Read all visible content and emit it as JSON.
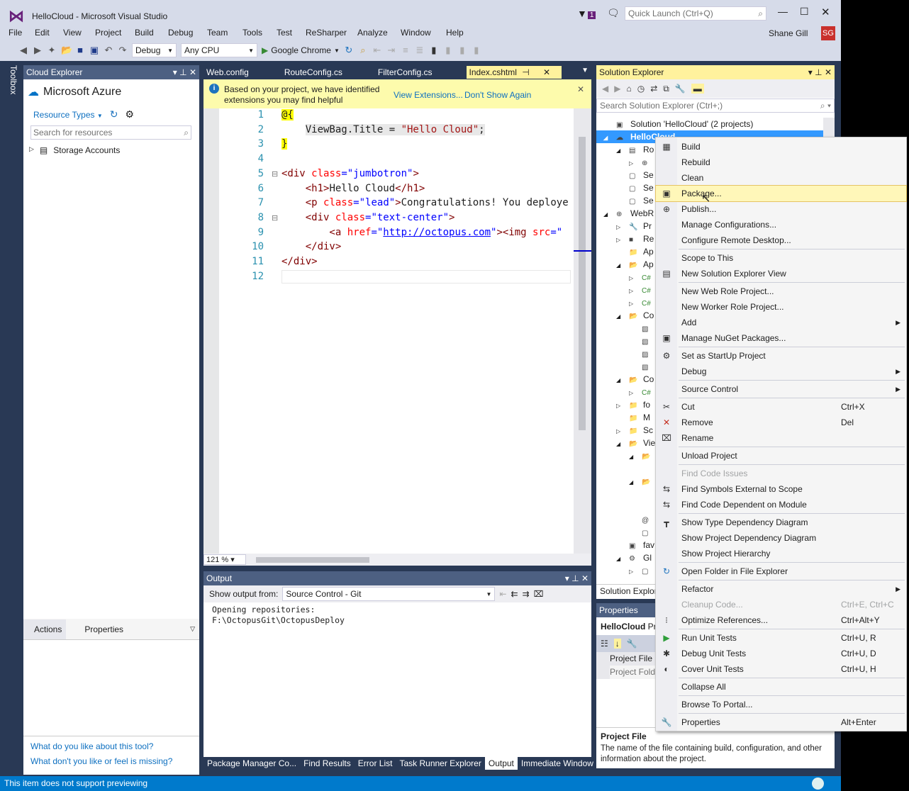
{
  "window": {
    "title": "HelloCloud - Microsoft Visual Studio",
    "notification_count": "1",
    "quick_launch_placeholder": "Quick Launch (Ctrl+Q)",
    "user_name": "Shane Gill",
    "user_initials": "SG",
    "accent": "#007acc"
  },
  "menu": [
    "File",
    "Edit",
    "View",
    "Project",
    "Build",
    "Debug",
    "Team",
    "Tools",
    "Test",
    "ReSharper",
    "Analyze",
    "Window",
    "Help"
  ],
  "toolbar": {
    "configuration": "Debug",
    "platform": "Any CPU",
    "run_target": "Google Chrome"
  },
  "toolbox_label": "Toolbox",
  "cloud_explorer": {
    "title": "Cloud Explorer",
    "account": "Microsoft Azure",
    "resource_types": "Resource Types",
    "search_placeholder": "Search for resources",
    "tree": [
      "Storage Accounts"
    ],
    "tabs": [
      "Actions",
      "Properties"
    ],
    "feedback_links": [
      "What do you like about this tool?",
      "What don't you like or feel is missing?"
    ]
  },
  "editor": {
    "tabs": [
      "Web.config",
      "RouteConfig.cs",
      "FilterConfig.cs",
      "Index.cshtml"
    ],
    "active_tab": "Index.cshtml",
    "infobar": {
      "message_line1": "Based on your project, we have identified",
      "message_line2": "extensions you may find helpful",
      "view_extensions": "View Extensions...",
      "dont_show": "Don't Show Again"
    },
    "zoom": "121 %",
    "lines": [
      [
        [
          "@{",
          "razor"
        ]
      ],
      [
        [
          "    ",
          ""
        ],
        [
          "ViewBag.Title = ",
          "cs"
        ],
        [
          "\"Hello Cloud\"",
          "csstr"
        ],
        [
          ";",
          "cs"
        ]
      ],
      [
        [
          "}",
          "razor"
        ]
      ],
      [],
      [
        [
          "<div ",
          "tag"
        ],
        [
          "class",
          "attr"
        ],
        [
          "=\"jumbotron\"",
          "str"
        ],
        [
          ">",
          "tag"
        ]
      ],
      [
        [
          "    <h1>",
          "tag"
        ],
        [
          "Hello Cloud",
          "plain"
        ],
        [
          "</h1>",
          "tag"
        ]
      ],
      [
        [
          "    <p ",
          "tag"
        ],
        [
          "class",
          "attr"
        ],
        [
          "=\"lead\"",
          "str"
        ],
        [
          ">",
          "tag"
        ],
        [
          "Congratulations! You deploye",
          "plain"
        ]
      ],
      [
        [
          "    <div ",
          "tag"
        ],
        [
          "class",
          "attr"
        ],
        [
          "=\"text-center\"",
          "str"
        ],
        [
          ">",
          "tag"
        ]
      ],
      [
        [
          "        <a ",
          "tag"
        ],
        [
          "href",
          "attr"
        ],
        [
          "=\"",
          "str"
        ],
        [
          "http://octopus.com",
          "link"
        ],
        [
          "\"",
          "str"
        ],
        [
          "><img ",
          "tag"
        ],
        [
          "src",
          "attr"
        ],
        [
          "=\"",
          "str"
        ]
      ],
      [
        [
          "    </div>",
          "tag"
        ]
      ],
      [
        [
          "</div>",
          "tag"
        ]
      ],
      []
    ]
  },
  "output": {
    "title": "Output",
    "show_from_label": "Show output from:",
    "source": "Source Control - Git",
    "text": [
      "Opening repositories:",
      "F:\\OctopusGit\\OctopusDeploy"
    ]
  },
  "bottom_tabs": [
    "Package Manager Co...",
    "Find Results",
    "Error List",
    "Task Runner Explorer",
    "Output",
    "Immediate Window"
  ],
  "bottom_active": "Output",
  "solution_explorer": {
    "title": "Solution Explorer",
    "search_placeholder": "Search Solution Explorer (Ctrl+;)",
    "footer_tab": "Solution Explor",
    "tree": [
      {
        "label": "Solution 'HelloCloud' (2 projects)",
        "depth": 0,
        "exp": "",
        "icon": "▣"
      },
      {
        "label": "HelloCloud",
        "depth": 0,
        "exp": "◢",
        "icon": "☁",
        "selected": true
      },
      {
        "label": "Ro",
        "depth": 1,
        "exp": "◢",
        "icon": "▤"
      },
      {
        "label": "",
        "depth": 2,
        "exp": "▷",
        "icon": "⊕"
      },
      {
        "label": "Se",
        "depth": 1,
        "exp": "",
        "icon": "▢"
      },
      {
        "label": "Se",
        "depth": 1,
        "exp": "",
        "icon": "▢"
      },
      {
        "label": "Se",
        "depth": 1,
        "exp": "",
        "icon": "▢"
      },
      {
        "label": "WebR",
        "depth": 0,
        "exp": "◢",
        "icon": "⊕"
      },
      {
        "label": "Pr",
        "depth": 1,
        "exp": "▷",
        "icon": "🔧"
      },
      {
        "label": "Re",
        "depth": 1,
        "exp": "▷",
        "icon": "■"
      },
      {
        "label": "Ap",
        "depth": 1,
        "exp": "",
        "icon": "📁"
      },
      {
        "label": "Ap",
        "depth": 1,
        "exp": "◢",
        "icon": "📂"
      },
      {
        "label": "",
        "depth": 2,
        "exp": "▷",
        "icon": "C#"
      },
      {
        "label": "",
        "depth": 2,
        "exp": "▷",
        "icon": "C#"
      },
      {
        "label": "",
        "depth": 2,
        "exp": "▷",
        "icon": "C#"
      },
      {
        "label": "Co",
        "depth": 1,
        "exp": "◢",
        "icon": "📂"
      },
      {
        "label": "",
        "depth": 2,
        "exp": "",
        "icon": "▧"
      },
      {
        "label": "",
        "depth": 2,
        "exp": "",
        "icon": "▧"
      },
      {
        "label": "",
        "depth": 2,
        "exp": "",
        "icon": "▨"
      },
      {
        "label": "",
        "depth": 2,
        "exp": "",
        "icon": "▧"
      },
      {
        "label": "Co",
        "depth": 1,
        "exp": "◢",
        "icon": "📂"
      },
      {
        "label": "",
        "depth": 2,
        "exp": "▷",
        "icon": "C#"
      },
      {
        "label": "fo",
        "depth": 1,
        "exp": "▷",
        "icon": "📁"
      },
      {
        "label": "M",
        "depth": 1,
        "exp": "",
        "icon": "📁"
      },
      {
        "label": "Sc",
        "depth": 1,
        "exp": "▷",
        "icon": "📁"
      },
      {
        "label": "Vie",
        "depth": 1,
        "exp": "◢",
        "icon": "📂"
      },
      {
        "label": "",
        "depth": 2,
        "exp": "◢",
        "icon": "📂"
      },
      {
        "label": "",
        "depth": 3,
        "exp": "",
        "icon": ""
      },
      {
        "label": "",
        "depth": 2,
        "exp": "◢",
        "icon": "📂"
      },
      {
        "label": "",
        "depth": 3,
        "exp": "",
        "icon": ""
      },
      {
        "label": "",
        "depth": 3,
        "exp": "",
        "icon": ""
      },
      {
        "label": "",
        "depth": 2,
        "exp": "",
        "icon": "@"
      },
      {
        "label": "",
        "depth": 2,
        "exp": "",
        "icon": "▢"
      },
      {
        "label": "fav",
        "depth": 1,
        "exp": "",
        "icon": "▣"
      },
      {
        "label": "Gl",
        "depth": 1,
        "exp": "◢",
        "icon": "⚙"
      },
      {
        "label": "",
        "depth": 2,
        "exp": "▷",
        "icon": "▢"
      }
    ]
  },
  "properties": {
    "title": "Properties",
    "object": "HelloCloud",
    "object_type": "Pr",
    "rows": [
      "Project File",
      "Project Fold"
    ],
    "desc_title": "Project File",
    "desc_text": "The name of the file containing build, configuration, and other information about the project."
  },
  "context_menu": [
    {
      "label": "Build",
      "icon": "▦"
    },
    {
      "label": "Rebuild"
    },
    {
      "label": "Clean"
    },
    {
      "label": "Package...",
      "icon": "▣",
      "highlighted": true
    },
    {
      "label": "Publish...",
      "icon": "⊕"
    },
    {
      "label": "Manage Configurations..."
    },
    {
      "label": "Configure Remote Desktop..."
    },
    {
      "sep": true
    },
    {
      "label": "Scope to This"
    },
    {
      "label": "New Solution Explorer View",
      "icon": "▤"
    },
    {
      "sep": true
    },
    {
      "label": "New Web Role Project..."
    },
    {
      "label": "New Worker Role Project..."
    },
    {
      "label": "Add",
      "submenu": true
    },
    {
      "label": "Manage NuGet Packages...",
      "icon": "▣"
    },
    {
      "sep": true
    },
    {
      "label": "Set as StartUp Project",
      "icon": "⚙"
    },
    {
      "label": "Debug",
      "submenu": true
    },
    {
      "sep": true
    },
    {
      "label": "Source Control",
      "submenu": true
    },
    {
      "sep": true
    },
    {
      "label": "Cut",
      "icon": "✂",
      "shortcut": "Ctrl+X"
    },
    {
      "label": "Remove",
      "icon": "✕",
      "shortcut": "Del",
      "icon_color": "#c42b1c"
    },
    {
      "label": "Rename",
      "icon": "⌧"
    },
    {
      "sep": true
    },
    {
      "label": "Unload Project"
    },
    {
      "sep": true
    },
    {
      "label": "Find Code Issues",
      "disabled": true
    },
    {
      "label": "Find Symbols External to Scope",
      "icon": "⇆"
    },
    {
      "label": "Find Code Dependent on Module",
      "icon": "⇆"
    },
    {
      "sep": true
    },
    {
      "label": "Show Type Dependency Diagram",
      "icon": "┳"
    },
    {
      "label": "Show Project Dependency Diagram"
    },
    {
      "label": "Show Project Hierarchy"
    },
    {
      "sep": true
    },
    {
      "label": "Open Folder in File Explorer",
      "icon": "↻",
      "icon_color": "#1e73be"
    },
    {
      "sep": true
    },
    {
      "label": "Refactor",
      "submenu": true
    },
    {
      "label": "Cleanup Code...",
      "disabled": true,
      "shortcut": "Ctrl+E, Ctrl+C"
    },
    {
      "label": "Optimize References...",
      "icon": "⁝",
      "shortcut": "Ctrl+Alt+Y"
    },
    {
      "sep": true
    },
    {
      "label": "Run Unit Tests",
      "icon": "▶",
      "shortcut": "Ctrl+U, R",
      "icon_color": "#2e9e3a"
    },
    {
      "label": "Debug Unit Tests",
      "icon": "✱",
      "shortcut": "Ctrl+U, D"
    },
    {
      "label": "Cover Unit Tests",
      "icon": "◐",
      "shortcut": "Ctrl+U, H"
    },
    {
      "sep": true
    },
    {
      "label": "Collapse All"
    },
    {
      "sep": true
    },
    {
      "label": "Browse To Portal..."
    },
    {
      "sep": true
    },
    {
      "label": "Properties",
      "icon": "🔧",
      "shortcut": "Alt+Enter"
    }
  ],
  "status": {
    "text": "This item does not support previewing"
  }
}
